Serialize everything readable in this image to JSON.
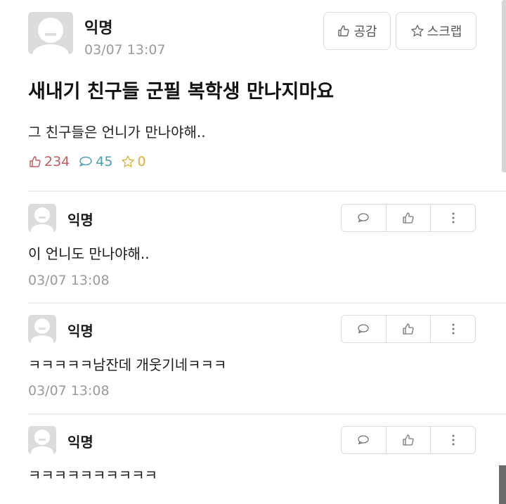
{
  "post": {
    "author": "익명",
    "timestamp": "03/07 13:07",
    "buttons": {
      "like": "공감",
      "scrap": "스크랩"
    },
    "title": "새내기 친구들 군필 복학생 만나지마요",
    "body": "그 친구들은 언니가 만나야해..",
    "stats": {
      "likes": "234",
      "comments": "45",
      "scraps": "0"
    },
    "colors": {
      "like": "#c25b5b",
      "comment": "#4a9eb8",
      "scrap": "#d9b233"
    }
  },
  "comments": [
    {
      "author": "익명",
      "text": "이 언니도 만나야해..",
      "timestamp": "03/07 13:08"
    },
    {
      "author": "익명",
      "text": "ㅋㅋㅋㅋㅋ남잔데 개웃기네ㅋㅋㅋ",
      "timestamp": "03/07 13:08"
    },
    {
      "author": "익명",
      "text": "ㅋㅋㅋㅋㅋㅋㅋㅋㅋㅋ",
      "timestamp": ""
    }
  ],
  "icons": {
    "like": "thumbs-up-icon",
    "comment": "speech-bubble-icon",
    "scrap": "star-icon",
    "more": "more-vertical-icon"
  }
}
